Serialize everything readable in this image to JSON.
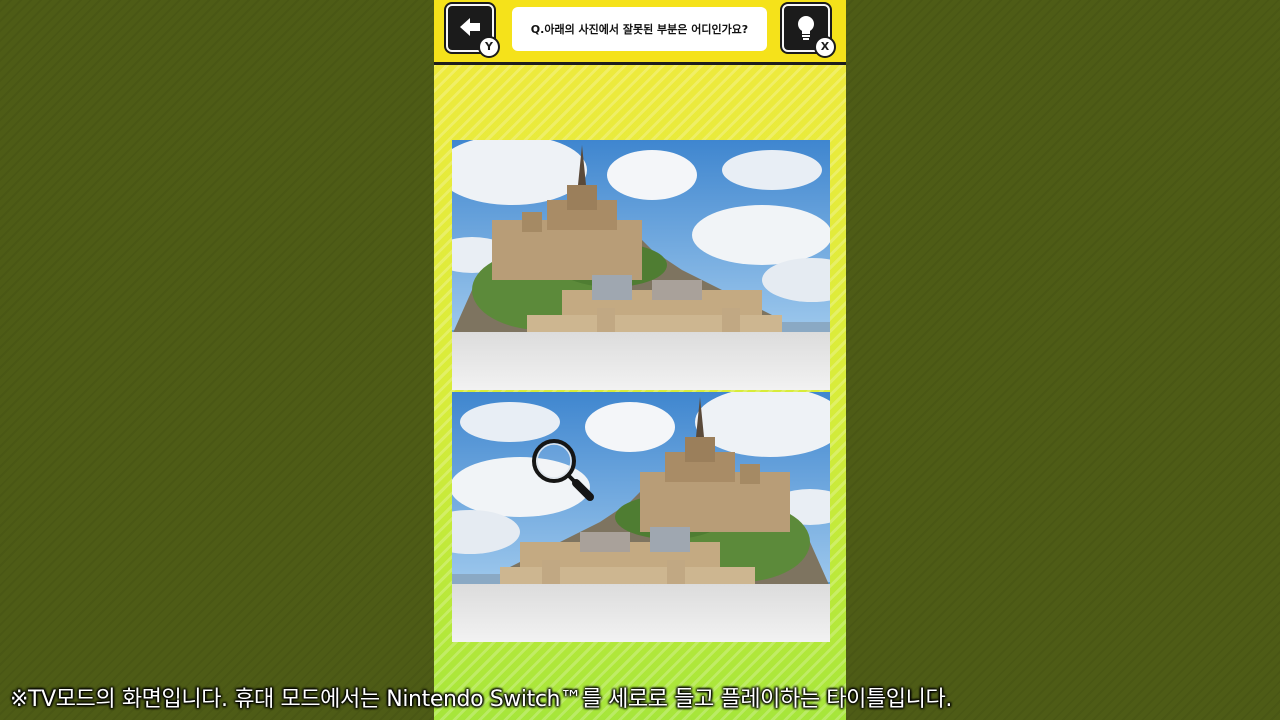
{
  "header": {
    "back_button": {
      "icon": "arrow-left-icon",
      "key_badge": "Y"
    },
    "question": "Q.아래의 사진에서 잘못된 부분은 어디인가요?",
    "hint_button": {
      "icon": "lightbulb-icon",
      "key_badge": "X"
    }
  },
  "puzzle": {
    "top_image": "original-photo",
    "bottom_image": "flipped-photo",
    "cursor_icon": "magnifier-icon"
  },
  "caption": "※TV모드의 화면입니다. 휴대 모드에서는 Nintendo Switch™를 세로로 들고 플레이하는 타이틀입니다.",
  "colors": {
    "background": "#4e5c16",
    "header_yellow": "#f5e21a",
    "phone_gradient_top": "#f2ea3c",
    "phone_gradient_bottom": "#a6e63a"
  }
}
